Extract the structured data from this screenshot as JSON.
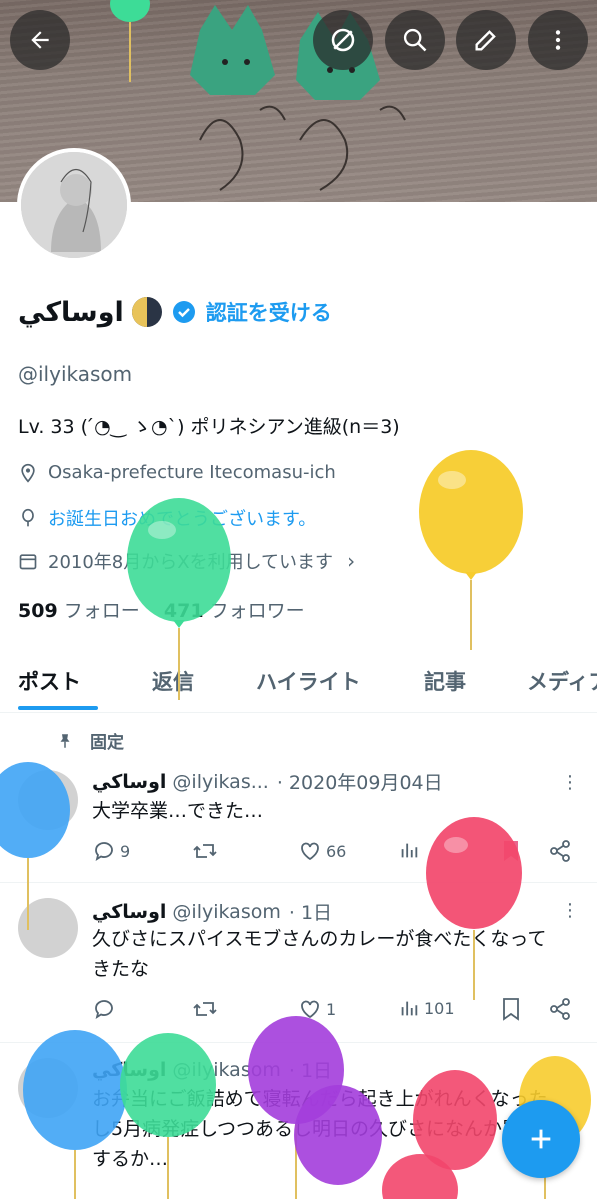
{
  "profile": {
    "display_name": "اوساكي",
    "verify_label": "認証を受ける",
    "handle": "@ilyikasom",
    "bio": "Lv. 33 ( ́◔‿ ゝ◔`) ポリネシアン進級(n＝3)",
    "location": "Osaka-prefecture Itecomasu-ich",
    "birthday": "お誕生日おめでとうございます。",
    "joined": "2010年8月からXを利用しています",
    "following_count": "509",
    "following_label": "フォロー",
    "followers_count": "471",
    "followers_label": "フォロワー"
  },
  "tabs": [
    "ポスト",
    "返信",
    "ハイライト",
    "記事",
    "メディア"
  ],
  "pinned_label": "固定",
  "posts": [
    {
      "name": "اوساكي",
      "handle": "@ilyikas...",
      "time": "· 2020年09月04日",
      "text": "大学卒業…できた…",
      "replies": "9",
      "likes": "66",
      "views": ""
    },
    {
      "name": "اوساكي",
      "handle": "@ilyikasom",
      "time": "· 1日",
      "text": "久びさにスパイスモブさんのカレーが食べたくなってきたな",
      "replies": "",
      "likes": "1",
      "views": "101"
    },
    {
      "name": "اوساكي",
      "handle": "@ilyikasom",
      "time": "· 1日",
      "text": "お弁当にご飯詰めて寝転んだら起き上がれんくなったし5月病発症しつつあるし明日の久びさになんか買うとするか…",
      "replies": "",
      "likes": "",
      "views": ""
    }
  ],
  "colors": {
    "accent": "#1d9bf0",
    "balloon_green": "#3ddc97",
    "balloon_yellow": "#f7cc2d",
    "balloon_blue": "#3fa4f5",
    "balloon_red": "#f2466b",
    "balloon_purple": "#a33ddb"
  }
}
